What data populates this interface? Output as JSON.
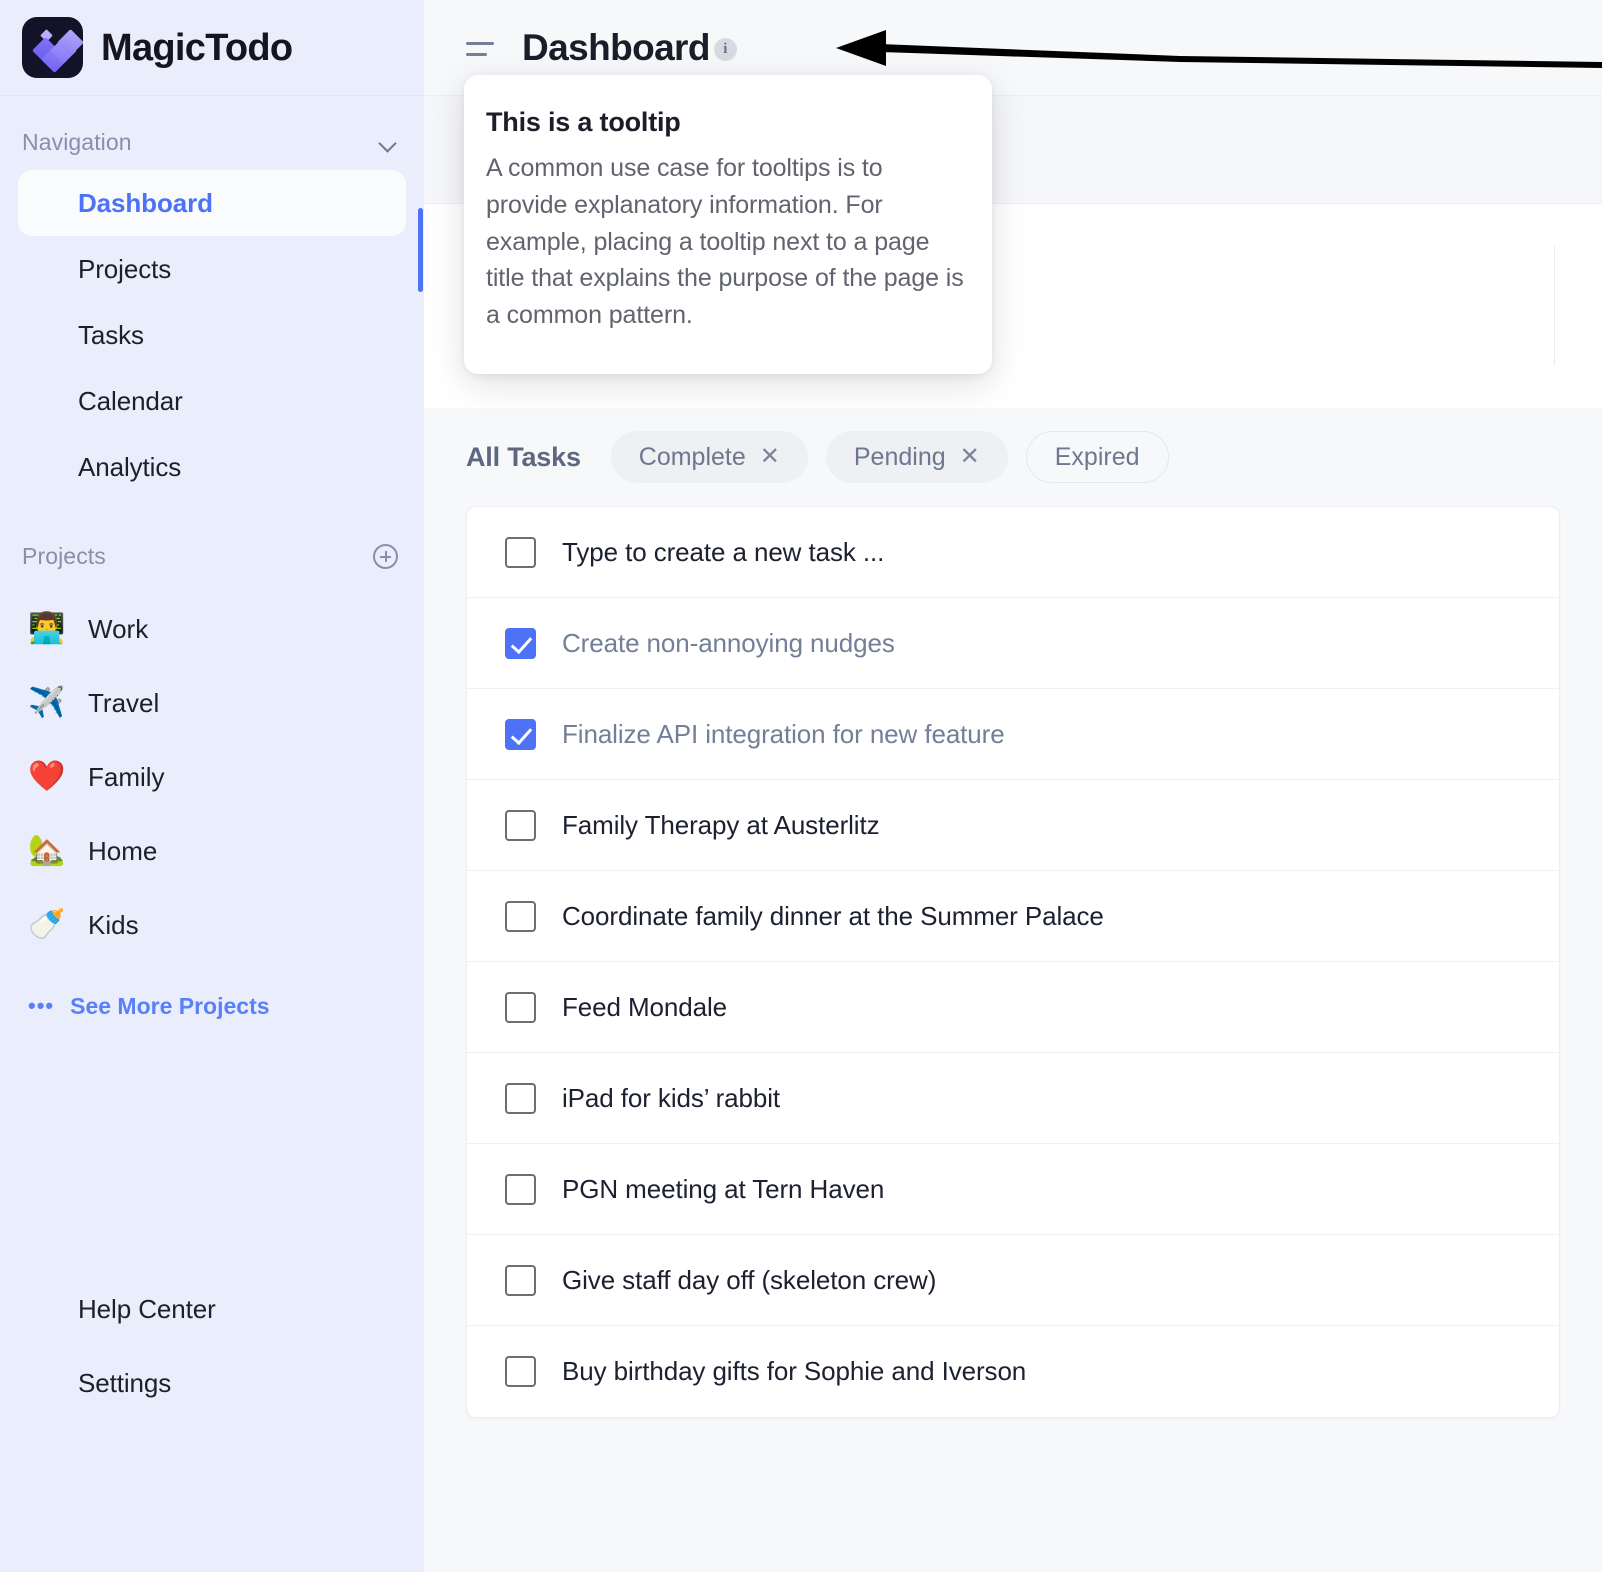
{
  "app": {
    "brand_name": "MagicTodo",
    "logo_icon": "magic-check-logo",
    "accent_color": "#4d72f5",
    "sidebar_bg": "#eaeefc",
    "logo_bg": "#131229"
  },
  "sidebar": {
    "navigation": {
      "title": "Navigation",
      "chevron_icon": "chevron-down-icon",
      "items": [
        {
          "label": "Dashboard",
          "active": true
        },
        {
          "label": "Projects",
          "active": false
        },
        {
          "label": "Tasks",
          "active": false
        },
        {
          "label": "Calendar",
          "active": false
        },
        {
          "label": "Analytics",
          "active": false
        }
      ]
    },
    "projects": {
      "title": "Projects",
      "add_icon": "plus-circle-icon",
      "items": [
        {
          "emoji": "👨‍💻",
          "label": "Work"
        },
        {
          "emoji": "✈️",
          "label": "Travel"
        },
        {
          "emoji": "❤️",
          "label": "Family"
        },
        {
          "emoji": "🏡",
          "label": "Home"
        },
        {
          "emoji": "🍼",
          "label": "Kids"
        }
      ],
      "see_more": {
        "label": "See More Projects",
        "icon": "ellipsis-icon"
      }
    },
    "bottom_items": [
      {
        "label": "Help Center"
      },
      {
        "label": "Settings"
      }
    ]
  },
  "header": {
    "menu_icon": "hamburger-menu-icon",
    "title": "Dashboard",
    "info_icon": "info-circle-icon",
    "info_glyph": "i"
  },
  "tooltip": {
    "title": "This is a tooltip",
    "body": "A common use case for tooltips is to provide explanatory information. For example, placing a tooltip next to a page title that explains the purpose of the page is a common pattern."
  },
  "annotation": {
    "arrow_icon": "left-pointing-arrow",
    "color": "#000000"
  },
  "filters": {
    "all_label": "All Tasks",
    "chips": [
      {
        "label": "Complete",
        "removable": true,
        "close_icon": "close-x-icon",
        "style": "filled"
      },
      {
        "label": "Pending",
        "removable": true,
        "close_icon": "close-x-icon",
        "style": "filled"
      },
      {
        "label": "Expired",
        "removable": false,
        "close_icon": "",
        "style": "outline"
      }
    ]
  },
  "tasks": {
    "new_task_placeholder": "Type to create a new task ...",
    "rows": [
      {
        "label": "Type to create a new task ...",
        "checked": false,
        "is_input": true
      },
      {
        "label": "Create non-annoying nudges",
        "checked": true,
        "is_input": false
      },
      {
        "label": "Finalize API integration for new feature",
        "checked": true,
        "is_input": false
      },
      {
        "label": "Family Therapy at Austerlitz",
        "checked": false,
        "is_input": false
      },
      {
        "label": "Coordinate family dinner at the Summer Palace",
        "checked": false,
        "is_input": false
      },
      {
        "label": "Feed Mondale",
        "checked": false,
        "is_input": false
      },
      {
        "label": "iPad for kids’ rabbit",
        "checked": false,
        "is_input": false
      },
      {
        "label": "PGN meeting at Tern Haven",
        "checked": false,
        "is_input": false
      },
      {
        "label": "Give staff day off (skeleton crew)",
        "checked": false,
        "is_input": false
      },
      {
        "label": "Buy birthday gifts for Sophie and Iverson",
        "checked": false,
        "is_input": false
      }
    ]
  }
}
